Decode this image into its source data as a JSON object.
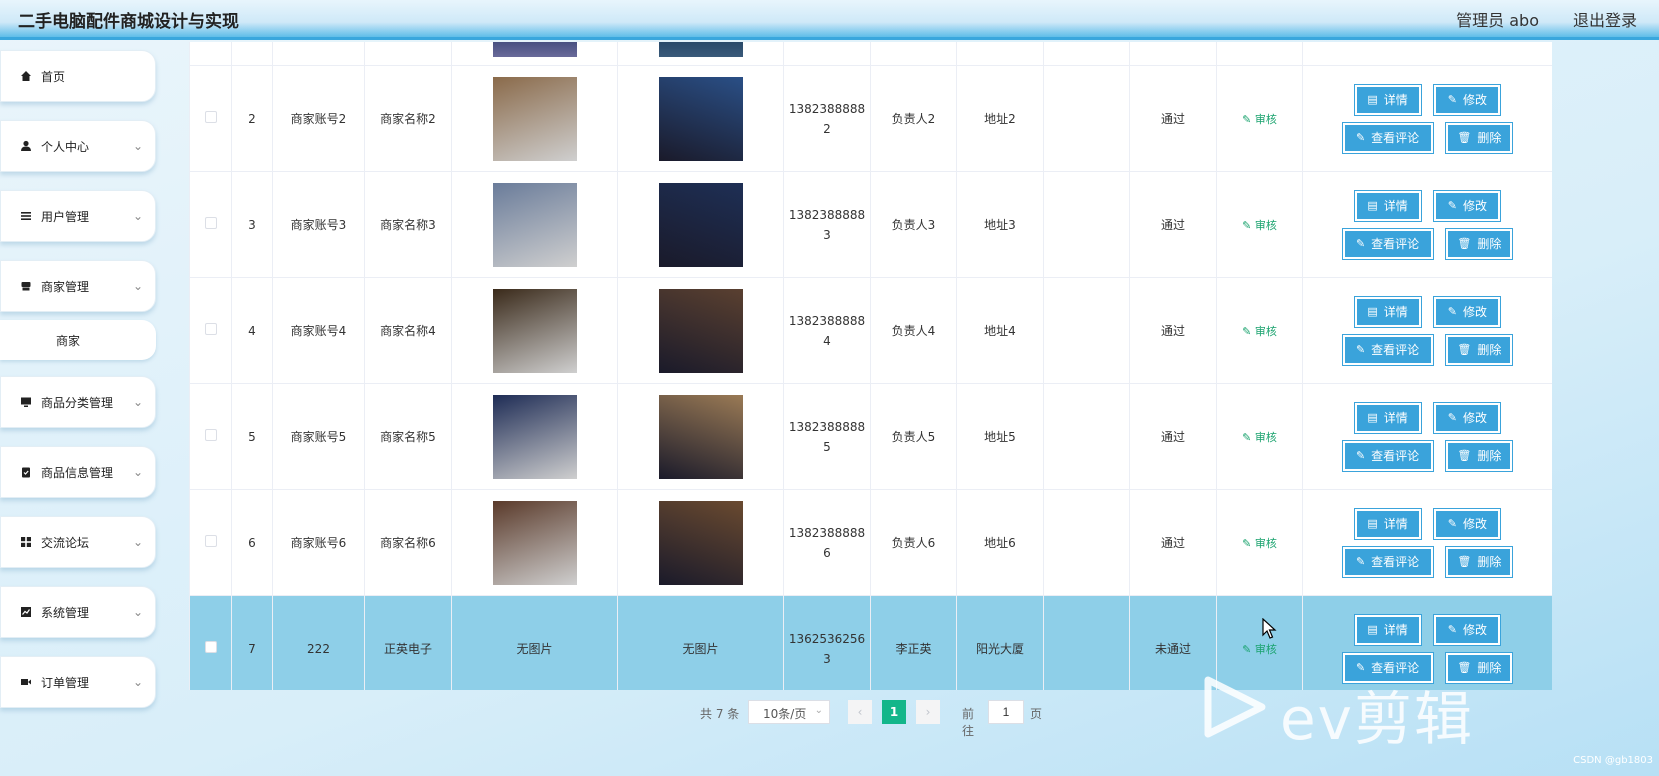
{
  "header": {
    "title": "二手电脑配件商城设计与实现",
    "admin": "管理员 abo",
    "logout": "退出登录"
  },
  "sidebar": {
    "items": [
      {
        "label": "首页",
        "icon": "home-icon"
      },
      {
        "label": "个人中心",
        "icon": "user-icon"
      },
      {
        "label": "用户管理",
        "icon": "list-icon"
      },
      {
        "label": "商家管理",
        "icon": "shop-icon"
      },
      {
        "label": "商品分类管理",
        "icon": "monitor-icon"
      },
      {
        "label": "商品信息管理",
        "icon": "clipboard-icon"
      },
      {
        "label": "交流论坛",
        "icon": "grid-icon"
      },
      {
        "label": "系统管理",
        "icon": "chart-icon"
      },
      {
        "label": "订单管理",
        "icon": "video-icon"
      }
    ],
    "sub_item": "商家"
  },
  "table": {
    "rows": [
      {
        "index": "2",
        "account": "商家账号2",
        "name": "商家名称2",
        "img1": "",
        "img2": "",
        "phone_a": "1382388888",
        "phone_b": "2",
        "contact": "负责人2",
        "address": "地址2",
        "status": "通过",
        "c1": "#8a6a4a",
        "c2": "#2a4f86"
      },
      {
        "index": "3",
        "account": "商家账号3",
        "name": "商家名称3",
        "img1": "",
        "img2": "",
        "phone_a": "1382388888",
        "phone_b": "3",
        "contact": "负责人3",
        "address": "地址3",
        "status": "通过",
        "c1": "#6a7c9a",
        "c2": "#1e2f55"
      },
      {
        "index": "4",
        "account": "商家账号4",
        "name": "商家名称4",
        "img1": "",
        "img2": "",
        "phone_a": "1382388888",
        "phone_b": "4",
        "contact": "负责人4",
        "address": "地址4",
        "status": "通过",
        "c1": "#3a2a1a",
        "c2": "#5a4030"
      },
      {
        "index": "5",
        "account": "商家账号5",
        "name": "商家名称5",
        "img1": "",
        "img2": "",
        "phone_a": "1382388888",
        "phone_b": "5",
        "contact": "负责人5",
        "address": "地址5",
        "status": "通过",
        "c1": "#1e2c55",
        "c2": "#9a7a55"
      },
      {
        "index": "6",
        "account": "商家账号6",
        "name": "商家名称6",
        "img1": "",
        "img2": "",
        "phone_a": "1382388888",
        "phone_b": "6",
        "contact": "负责人6",
        "address": "地址6",
        "status": "通过",
        "c1": "#5a3a2a",
        "c2": "#6a4a30"
      }
    ],
    "last_row": {
      "index": "7",
      "account": "222",
      "name": "正英电子",
      "img1": "无图片",
      "img2": "无图片",
      "phone_a": "1362536256",
      "phone_b": "3",
      "contact": "李正英",
      "address": "阳光大厦",
      "status": "未通过"
    },
    "actions": {
      "audit": "审核",
      "detail": "详情",
      "edit": "修改",
      "comments": "查看评论",
      "delete": "删除"
    }
  },
  "pagination": {
    "total_prefix": "共 7 条",
    "page_size": "10条/页",
    "current_page": "1",
    "goto_label": "前往",
    "goto_value": "1",
    "page_suffix": "页"
  },
  "watermark": {
    "text": "ev剪辑",
    "credit": "CSDN @gb1803"
  },
  "colors": {
    "primary": "#3aa3db",
    "accent_green": "#13b68a",
    "selected_row": "#8ecfe8"
  }
}
